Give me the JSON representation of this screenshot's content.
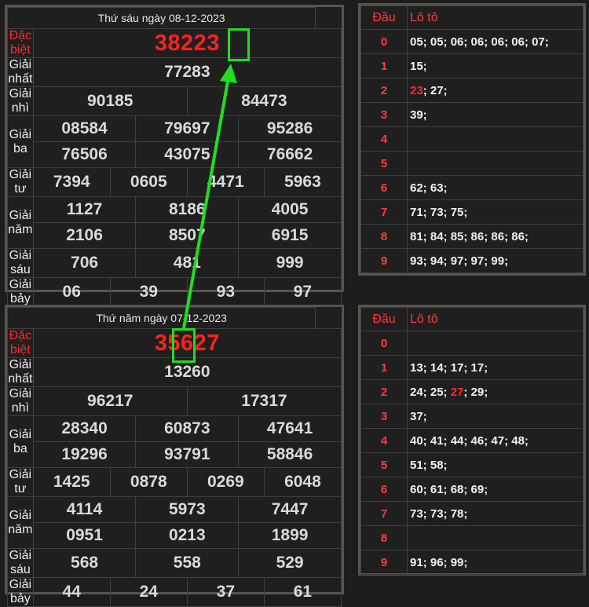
{
  "draws": [
    {
      "title": "Thứ sáu ngày 08-12-2023",
      "labels": [
        "Đặc biệt",
        "Giải nhất",
        "Giải nhì",
        "Giải ba",
        "Giải tư",
        "Giải năm",
        "Giải sáu",
        "Giải bảy"
      ],
      "db": "38223",
      "g1": "77283",
      "g2": [
        "90185",
        "84473"
      ],
      "g3": [
        "08584",
        "79697",
        "95286",
        "76506",
        "43075",
        "76662"
      ],
      "g4": [
        "7394",
        "0605",
        "4471",
        "5963"
      ],
      "g5": [
        "1127",
        "8186",
        "4005",
        "2106",
        "8507",
        "6915"
      ],
      "g6": [
        "706",
        "481",
        "999"
      ],
      "g7": [
        "06",
        "39",
        "93",
        "97"
      ],
      "loto_header": {
        "dau": "Đầu",
        "loto": "Lô tô"
      },
      "loto": [
        {
          "d": "0",
          "pre": "05; 05; 06; 06; 06; 06; 07;",
          "hl": "",
          "post": ""
        },
        {
          "d": "1",
          "pre": "15;",
          "hl": "",
          "post": ""
        },
        {
          "d": "2",
          "pre": "",
          "hl": "23",
          "post": "; 27;"
        },
        {
          "d": "3",
          "pre": "39;",
          "hl": "",
          "post": ""
        },
        {
          "d": "4",
          "pre": "",
          "hl": "",
          "post": ""
        },
        {
          "d": "5",
          "pre": "",
          "hl": "",
          "post": ""
        },
        {
          "d": "6",
          "pre": "62; 63;",
          "hl": "",
          "post": ""
        },
        {
          "d": "7",
          "pre": "71; 73; 75;",
          "hl": "",
          "post": ""
        },
        {
          "d": "8",
          "pre": "81; 84; 85; 86; 86; 86;",
          "hl": "",
          "post": ""
        },
        {
          "d": "9",
          "pre": "93; 94; 97; 97; 99;",
          "hl": "",
          "post": ""
        }
      ]
    },
    {
      "title": "Thứ năm ngày 07-12-2023",
      "labels": [
        "Đặc biệt",
        "Giải nhất",
        "Giải nhì",
        "Giải ba",
        "Giải tư",
        "Giải năm",
        "Giải sáu",
        "Giải bảy"
      ],
      "db": "35627",
      "g1": "13260",
      "g2": [
        "96217",
        "17317"
      ],
      "g3": [
        "28340",
        "60873",
        "47641",
        "19296",
        "93791",
        "58846"
      ],
      "g4": [
        "1425",
        "0878",
        "0269",
        "6048"
      ],
      "g5": [
        "4114",
        "5973",
        "7447",
        "0951",
        "0213",
        "1899"
      ],
      "g6": [
        "568",
        "558",
        "529"
      ],
      "g7": [
        "44",
        "24",
        "37",
        "61"
      ],
      "loto_header": {
        "dau": "Đầu",
        "loto": "Lô tô"
      },
      "loto": [
        {
          "d": "0",
          "pre": "",
          "hl": "",
          "post": ""
        },
        {
          "d": "1",
          "pre": "13; 14; 17; 17;",
          "hl": "",
          "post": ""
        },
        {
          "d": "2",
          "pre": "24; 25; ",
          "hl": "27",
          "post": "; 29;"
        },
        {
          "d": "3",
          "pre": "37;",
          "hl": "",
          "post": ""
        },
        {
          "d": "4",
          "pre": "40; 41; 44; 46; 47; 48;",
          "hl": "",
          "post": ""
        },
        {
          "d": "5",
          "pre": "51; 58;",
          "hl": "",
          "post": ""
        },
        {
          "d": "6",
          "pre": "60; 61; 68; 69;",
          "hl": "",
          "post": ""
        },
        {
          "d": "7",
          "pre": "73; 73; 78;",
          "hl": "",
          "post": ""
        },
        {
          "d": "8",
          "pre": "",
          "hl": "",
          "post": ""
        },
        {
          "d": "9",
          "pre": "91; 96; 99;",
          "hl": "",
          "post": ""
        }
      ]
    }
  ],
  "colors": {
    "special": "#ff2020",
    "highlight_box": "#22dd22",
    "border": "#57544a",
    "background": "#1c1c1c"
  }
}
